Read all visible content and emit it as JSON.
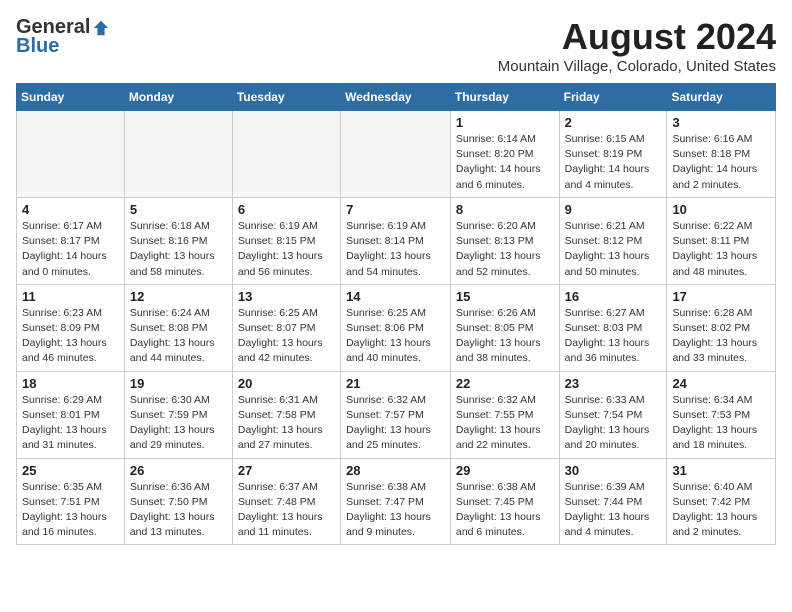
{
  "header": {
    "logo_general": "General",
    "logo_blue": "Blue",
    "month_year": "August 2024",
    "location": "Mountain Village, Colorado, United States"
  },
  "days_of_week": [
    "Sunday",
    "Monday",
    "Tuesday",
    "Wednesday",
    "Thursday",
    "Friday",
    "Saturday"
  ],
  "weeks": [
    [
      {
        "day": "",
        "empty": true
      },
      {
        "day": "",
        "empty": true
      },
      {
        "day": "",
        "empty": true
      },
      {
        "day": "",
        "empty": true
      },
      {
        "day": "1",
        "sunrise": "6:14 AM",
        "sunset": "8:20 PM",
        "daylight": "14 hours and 6 minutes."
      },
      {
        "day": "2",
        "sunrise": "6:15 AM",
        "sunset": "8:19 PM",
        "daylight": "14 hours and 4 minutes."
      },
      {
        "day": "3",
        "sunrise": "6:16 AM",
        "sunset": "8:18 PM",
        "daylight": "14 hours and 2 minutes."
      }
    ],
    [
      {
        "day": "4",
        "sunrise": "6:17 AM",
        "sunset": "8:17 PM",
        "daylight": "14 hours and 0 minutes."
      },
      {
        "day": "5",
        "sunrise": "6:18 AM",
        "sunset": "8:16 PM",
        "daylight": "13 hours and 58 minutes."
      },
      {
        "day": "6",
        "sunrise": "6:19 AM",
        "sunset": "8:15 PM",
        "daylight": "13 hours and 56 minutes."
      },
      {
        "day": "7",
        "sunrise": "6:19 AM",
        "sunset": "8:14 PM",
        "daylight": "13 hours and 54 minutes."
      },
      {
        "day": "8",
        "sunrise": "6:20 AM",
        "sunset": "8:13 PM",
        "daylight": "13 hours and 52 minutes."
      },
      {
        "day": "9",
        "sunrise": "6:21 AM",
        "sunset": "8:12 PM",
        "daylight": "13 hours and 50 minutes."
      },
      {
        "day": "10",
        "sunrise": "6:22 AM",
        "sunset": "8:11 PM",
        "daylight": "13 hours and 48 minutes."
      }
    ],
    [
      {
        "day": "11",
        "sunrise": "6:23 AM",
        "sunset": "8:09 PM",
        "daylight": "13 hours and 46 minutes."
      },
      {
        "day": "12",
        "sunrise": "6:24 AM",
        "sunset": "8:08 PM",
        "daylight": "13 hours and 44 minutes."
      },
      {
        "day": "13",
        "sunrise": "6:25 AM",
        "sunset": "8:07 PM",
        "daylight": "13 hours and 42 minutes."
      },
      {
        "day": "14",
        "sunrise": "6:25 AM",
        "sunset": "8:06 PM",
        "daylight": "13 hours and 40 minutes."
      },
      {
        "day": "15",
        "sunrise": "6:26 AM",
        "sunset": "8:05 PM",
        "daylight": "13 hours and 38 minutes."
      },
      {
        "day": "16",
        "sunrise": "6:27 AM",
        "sunset": "8:03 PM",
        "daylight": "13 hours and 36 minutes."
      },
      {
        "day": "17",
        "sunrise": "6:28 AM",
        "sunset": "8:02 PM",
        "daylight": "13 hours and 33 minutes."
      }
    ],
    [
      {
        "day": "18",
        "sunrise": "6:29 AM",
        "sunset": "8:01 PM",
        "daylight": "13 hours and 31 minutes."
      },
      {
        "day": "19",
        "sunrise": "6:30 AM",
        "sunset": "7:59 PM",
        "daylight": "13 hours and 29 minutes."
      },
      {
        "day": "20",
        "sunrise": "6:31 AM",
        "sunset": "7:58 PM",
        "daylight": "13 hours and 27 minutes."
      },
      {
        "day": "21",
        "sunrise": "6:32 AM",
        "sunset": "7:57 PM",
        "daylight": "13 hours and 25 minutes."
      },
      {
        "day": "22",
        "sunrise": "6:32 AM",
        "sunset": "7:55 PM",
        "daylight": "13 hours and 22 minutes."
      },
      {
        "day": "23",
        "sunrise": "6:33 AM",
        "sunset": "7:54 PM",
        "daylight": "13 hours and 20 minutes."
      },
      {
        "day": "24",
        "sunrise": "6:34 AM",
        "sunset": "7:53 PM",
        "daylight": "13 hours and 18 minutes."
      }
    ],
    [
      {
        "day": "25",
        "sunrise": "6:35 AM",
        "sunset": "7:51 PM",
        "daylight": "13 hours and 16 minutes."
      },
      {
        "day": "26",
        "sunrise": "6:36 AM",
        "sunset": "7:50 PM",
        "daylight": "13 hours and 13 minutes."
      },
      {
        "day": "27",
        "sunrise": "6:37 AM",
        "sunset": "7:48 PM",
        "daylight": "13 hours and 11 minutes."
      },
      {
        "day": "28",
        "sunrise": "6:38 AM",
        "sunset": "7:47 PM",
        "daylight": "13 hours and 9 minutes."
      },
      {
        "day": "29",
        "sunrise": "6:38 AM",
        "sunset": "7:45 PM",
        "daylight": "13 hours and 6 minutes."
      },
      {
        "day": "30",
        "sunrise": "6:39 AM",
        "sunset": "7:44 PM",
        "daylight": "13 hours and 4 minutes."
      },
      {
        "day": "31",
        "sunrise": "6:40 AM",
        "sunset": "7:42 PM",
        "daylight": "13 hours and 2 minutes."
      }
    ]
  ],
  "labels": {
    "sunrise": "Sunrise:",
    "sunset": "Sunset:",
    "daylight": "Daylight:"
  }
}
